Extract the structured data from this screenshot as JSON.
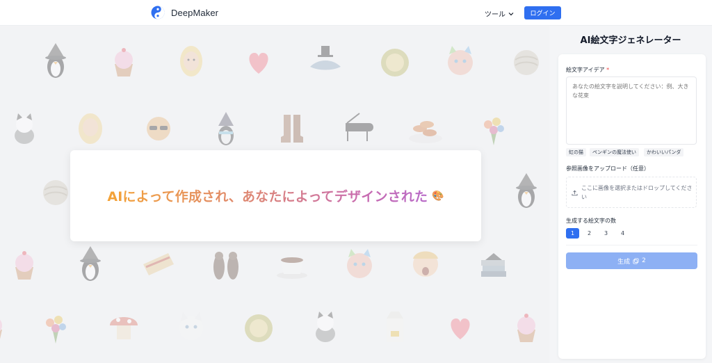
{
  "header": {
    "brand": "DeepMaker",
    "tools_label": "ツール",
    "login_label": "ログイン"
  },
  "hero": {
    "title": "AIによって作成され、あなたによってデザインされた",
    "icon": "🎨"
  },
  "gallery": {
    "items": [
      "penguin-witch",
      "cupcake",
      "blonde-woman",
      "heart",
      "shark-tophat",
      "durian",
      "rainbow-cat",
      "yarn-ball",
      "tabby-cat",
      "blonde-girl",
      "cat-sunglasses",
      "penguin-wizard",
      "boots",
      "grand-piano",
      "fried-food",
      "flower-bouquet",
      "yarn-ball",
      "penguin-witch",
      "cupcake",
      "penguin-witch",
      "burrito",
      "otters",
      "coffee-cup",
      "rainbow-cat",
      "surprised-face",
      "books",
      "cupcake",
      "flower-bouquet",
      "mushroom-house",
      "white-cat",
      "durian",
      "tabby-cat",
      "milk-carton",
      "heart",
      "cupcake"
    ]
  },
  "panel": {
    "title": "AI絵文字ジェネレーター",
    "idea_label": "絵文字アイデア",
    "required_mark": "*",
    "idea_placeholder": "あなたの絵文字を説明してください：例、大きな花束",
    "chips": [
      "虹の猫",
      "ペンギンの魔法使い",
      "かわいいパンダ"
    ],
    "upload_label": "参照画像をアップロード（任意）",
    "upload_text": "ここに画像を選択またはドロップしてください",
    "count_label": "生成する絵文字の数",
    "counts": [
      "1",
      "2",
      "3",
      "4"
    ],
    "selected_count": "1",
    "generate_label": "生成",
    "generate_cost": "2",
    "colors": {
      "primary": "#2f6ff0",
      "disabled": "#8db0f4"
    }
  }
}
